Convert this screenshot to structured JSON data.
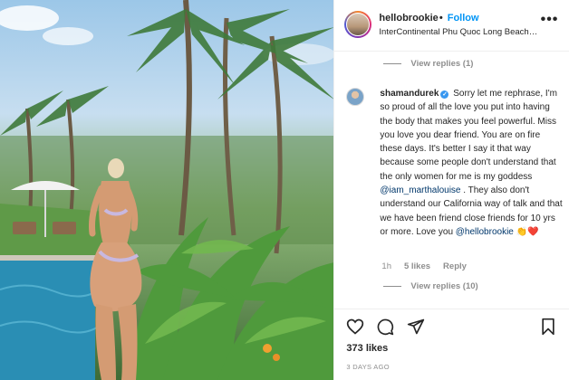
{
  "photo": {
    "alt_icon": "post-photo"
  },
  "header": {
    "username": "hellobrookie",
    "separator": "•",
    "follow_label": "Follow",
    "location": "InterContinental Phu Quoc Long Beach Res...",
    "more_icon": "more-options-icon",
    "more_label": "•••"
  },
  "replies_top": {
    "label": "View replies (1)"
  },
  "comment": {
    "username": "shamandurek",
    "verified_icon": "verified-badge-icon",
    "verified_glyph": "✓",
    "text_1": "Sorry let me rephrase, I'm so proud of all the love you put into having the body that makes you feel powerful. Miss you love you dear friend. You are on fire these days. It's better I say it that way because some people don't understand that the only women for me is my goddess ",
    "mention_1": "@iam_marthalouise",
    "text_2": " . They also don't understand our California way of talk and that we have been friend close friends for 10 yrs or more. Love you ",
    "mention_2": "@hellobrookie",
    "emojis": "👏❤️",
    "time": "1h",
    "likes": "5 likes",
    "reply_label": "Reply"
  },
  "replies_bottom": {
    "label": "View replies (10)"
  },
  "actions": {
    "like_icon": "heart-icon",
    "comment_icon": "comment-icon",
    "share_icon": "share-icon",
    "save_icon": "bookmark-icon"
  },
  "likes_count": "373 likes",
  "post_age": "3 DAYS AGO",
  "colors": {
    "link": "#0095f6",
    "mention": "#00376b",
    "muted": "#8e8e8e",
    "text": "#262626",
    "verified": "#3897f0"
  }
}
